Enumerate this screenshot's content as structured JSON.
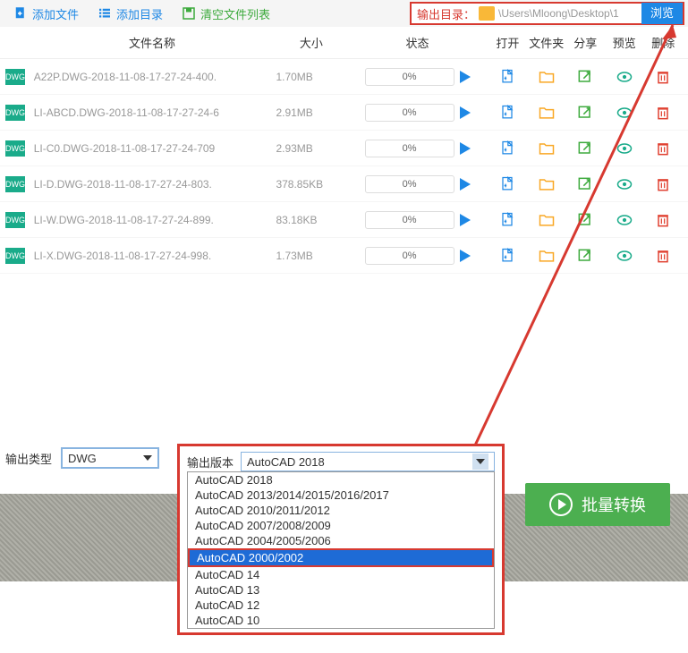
{
  "toolbar": {
    "add_file": "添加文件",
    "add_dir": "添加目录",
    "clear_list": "清空文件列表"
  },
  "output_dir": {
    "label": "输出目录：",
    "path": "\\Users\\Mloong\\Desktop\\1",
    "browse": "浏览"
  },
  "headers": {
    "name": "文件名称",
    "size": "大小",
    "status": "状态",
    "open": "打开",
    "folder": "文件夹",
    "share": "分享",
    "preview": "预览",
    "delete": "删除"
  },
  "files": [
    {
      "name": "A22P.DWG-2018-11-08-17-27-24-400.",
      "size": "1.70MB",
      "progress": "0%"
    },
    {
      "name": "LI-ABCD.DWG-2018-11-08-17-27-24-6",
      "size": "2.91MB",
      "progress": "0%"
    },
    {
      "name": "LI-C0.DWG-2018-11-08-17-27-24-709",
      "size": "2.93MB",
      "progress": "0%"
    },
    {
      "name": "LI-D.DWG-2018-11-08-17-27-24-803.",
      "size": "378.85KB",
      "progress": "0%"
    },
    {
      "name": "LI-W.DWG-2018-11-08-17-27-24-899.",
      "size": "83.18KB",
      "progress": "0%"
    },
    {
      "name": "LI-X.DWG-2018-11-08-17-27-24-998.",
      "size": "1.73MB",
      "progress": "0%"
    }
  ],
  "badge": "DWG",
  "output_type": {
    "label": "输出类型",
    "value": "DWG"
  },
  "output_version": {
    "label": "输出版本",
    "selected": "AutoCAD 2018",
    "options": [
      "AutoCAD 2018",
      "AutoCAD 2013/2014/2015/2016/2017",
      "AutoCAD 2010/2011/2012",
      "AutoCAD 2007/2008/2009",
      "AutoCAD 2004/2005/2006",
      "AutoCAD 2000/2002",
      "AutoCAD 14",
      "AutoCAD 13",
      "AutoCAD 12",
      "AutoCAD 10"
    ],
    "highlighted_index": 5
  },
  "convert_button": "批量转换"
}
